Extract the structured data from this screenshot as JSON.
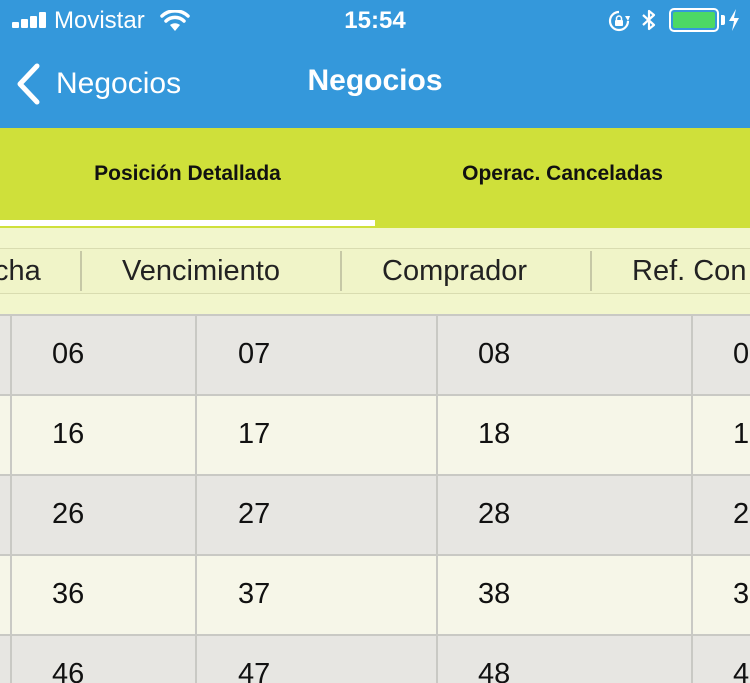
{
  "status_bar": {
    "carrier": "Movistar",
    "time": "15:54",
    "battery_color": "#4cd964"
  },
  "nav": {
    "back_label": "Negocios",
    "title": "Negocios",
    "background": "#3498db"
  },
  "tabs": [
    {
      "label": "Posición Detallada",
      "selected": true
    },
    {
      "label": "Operac. Canceladas",
      "selected": false
    }
  ],
  "tab_color": "#cfe03a",
  "columns": [
    "cha",
    "Vencimiento",
    "Comprador",
    "Ref. Con"
  ],
  "rows": [
    [
      "06",
      "07",
      "08",
      "0"
    ],
    [
      "16",
      "17",
      "18",
      "1"
    ],
    [
      "26",
      "27",
      "28",
      "2"
    ],
    [
      "36",
      "37",
      "38",
      "3"
    ],
    [
      "46",
      "47",
      "48",
      "4"
    ]
  ]
}
